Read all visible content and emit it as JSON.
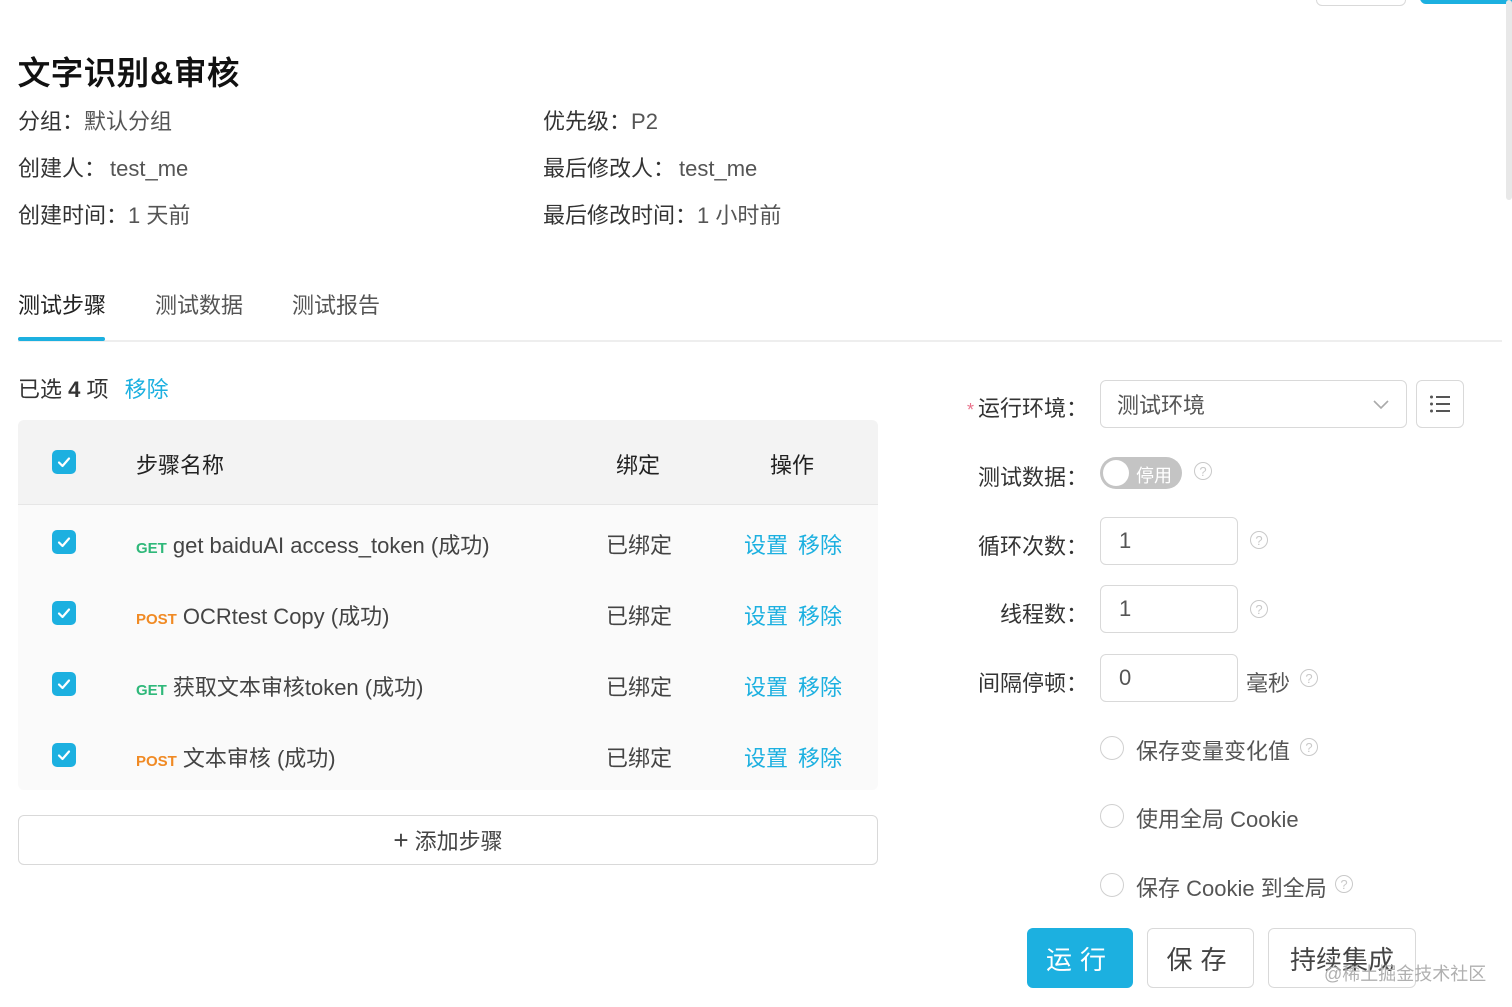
{
  "header": {
    "title": "文字识别&审核",
    "group_label": "分组：",
    "group_value": "默认分组",
    "priority_label": "优先级：",
    "priority_value": "P2",
    "creator_label": "创建人：",
    "creator_value": "test_me",
    "modifier_label": "最后修改人：",
    "modifier_value": "test_me",
    "created_label": "创建时间：",
    "created_value": "1 天前",
    "modified_label": "最后修改时间：",
    "modified_value": "1 小时前"
  },
  "tabs": [
    {
      "label": "测试步骤",
      "active": true
    },
    {
      "label": "测试数据",
      "active": false
    },
    {
      "label": "测试报告",
      "active": false
    }
  ],
  "selection": {
    "prefix": "已选",
    "count": "4",
    "suffix": "项",
    "remove_label": "移除"
  },
  "table": {
    "headers": {
      "name": "步骤名称",
      "bind": "绑定",
      "ops": "操作"
    },
    "rows": [
      {
        "method": "GET",
        "name": "get baiduAI access_token (成功)",
        "bind": "已绑定",
        "set": "设置",
        "remove": "移除"
      },
      {
        "method": "POST",
        "name": "OCRtest Copy (成功)",
        "bind": "已绑定",
        "set": "设置",
        "remove": "移除"
      },
      {
        "method": "GET",
        "name": "获取文本审核token (成功)",
        "bind": "已绑定",
        "set": "设置",
        "remove": "移除"
      },
      {
        "method": "POST",
        "name": "文本审核 (成功)",
        "bind": "已绑定",
        "set": "设置",
        "remove": "移除"
      }
    ],
    "add_step_label": "添加步骤"
  },
  "form": {
    "env_label": "运行环境：",
    "env_value": "测试环境",
    "test_data_label": "测试数据：",
    "test_data_toggle": "停用",
    "loop_label": "循环次数：",
    "loop_value": "1",
    "threads_label": "线程数：",
    "threads_value": "1",
    "interval_label": "间隔停顿：",
    "interval_value": "0",
    "interval_unit": "毫秒",
    "opt_save_vars": "保存变量变化值",
    "opt_global_cookie": "使用全局 Cookie",
    "opt_save_cookie": "保存 Cookie 到全局"
  },
  "actions": {
    "run": "运行",
    "save": "保存",
    "ci": "持续集成"
  },
  "watermark": "@稀土掘金技术社区",
  "colors": {
    "accent": "#1cb0e0",
    "get": "#2fb87a",
    "post": "#f08a24"
  }
}
